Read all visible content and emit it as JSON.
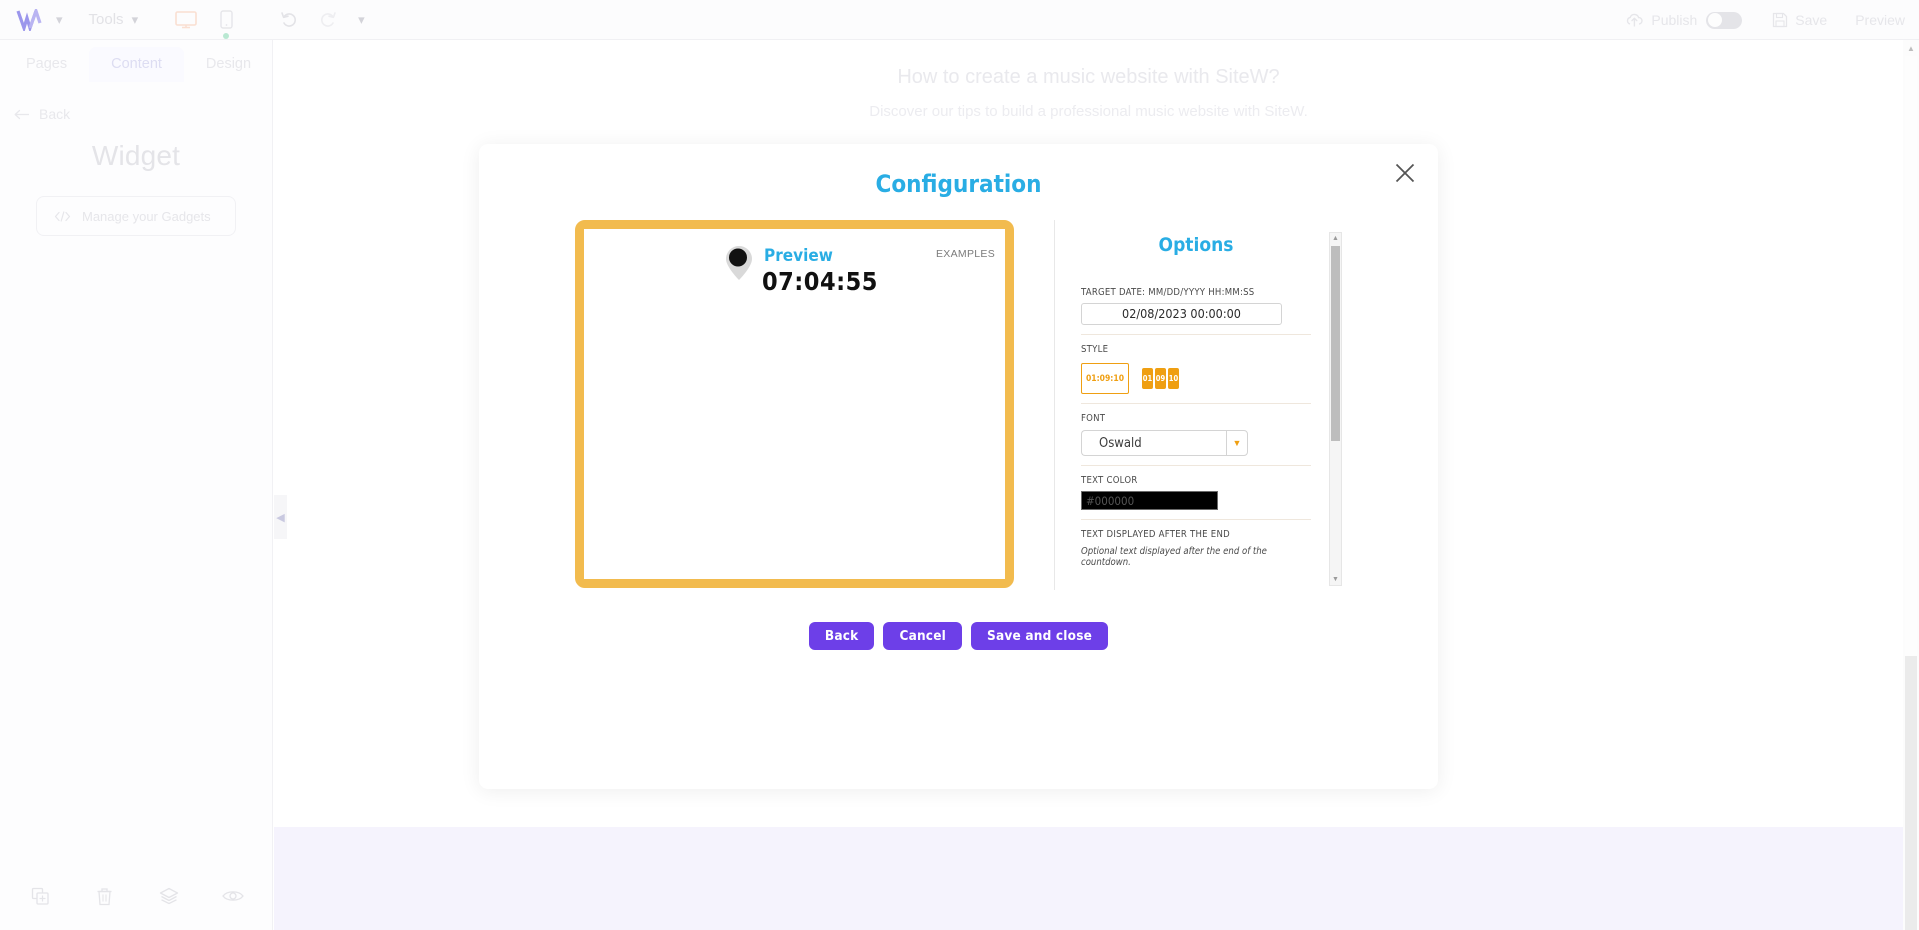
{
  "topbar": {
    "logo": "sitew-logo",
    "tools_label": "Tools",
    "publish_label": "Publish",
    "save_label": "Save",
    "preview_label": "Preview",
    "accent_logo_color": "#9b96ec"
  },
  "sidebar": {
    "tabs": [
      {
        "label": "Pages",
        "active": false
      },
      {
        "label": "Content",
        "active": true
      },
      {
        "label": "Design",
        "active": false
      }
    ],
    "back_label": "Back",
    "section_title": "Widget",
    "gadgets_label": "Manage your Gadgets"
  },
  "page": {
    "heading": "How to create a music website with SiteW?",
    "subheading": "Discover our tips to build a professional music website with SiteW."
  },
  "modal": {
    "title": "Configuration",
    "close_icon": "close-icon",
    "preview": {
      "label": "Preview",
      "examples_label": "EXAMPLES",
      "countdown_value": "07:04:55",
      "frame_color": "#f2bb4e"
    },
    "options": {
      "title": "Options",
      "target_date": {
        "label": "TARGET DATE: MM/DD/YYYY HH:MM:SS",
        "value": "02/08/2023 00:00:00"
      },
      "style": {
        "label": "STYLE",
        "option_plain": "01:09:10",
        "option_flip": [
          "01",
          "09",
          "10"
        ],
        "accent_color": "#ef9f12"
      },
      "font": {
        "label": "FONT",
        "value": "Oswald"
      },
      "text_color": {
        "label": "TEXT COLOR",
        "value": "#000000"
      },
      "after_end": {
        "label": "TEXT DISPLAYED AFTER THE END",
        "hint": "Optional text displayed after the end of the countdown."
      }
    },
    "buttons": {
      "back": "Back",
      "cancel": "Cancel",
      "save_and_close": "Save and close",
      "color": "#6d3fe8"
    }
  }
}
